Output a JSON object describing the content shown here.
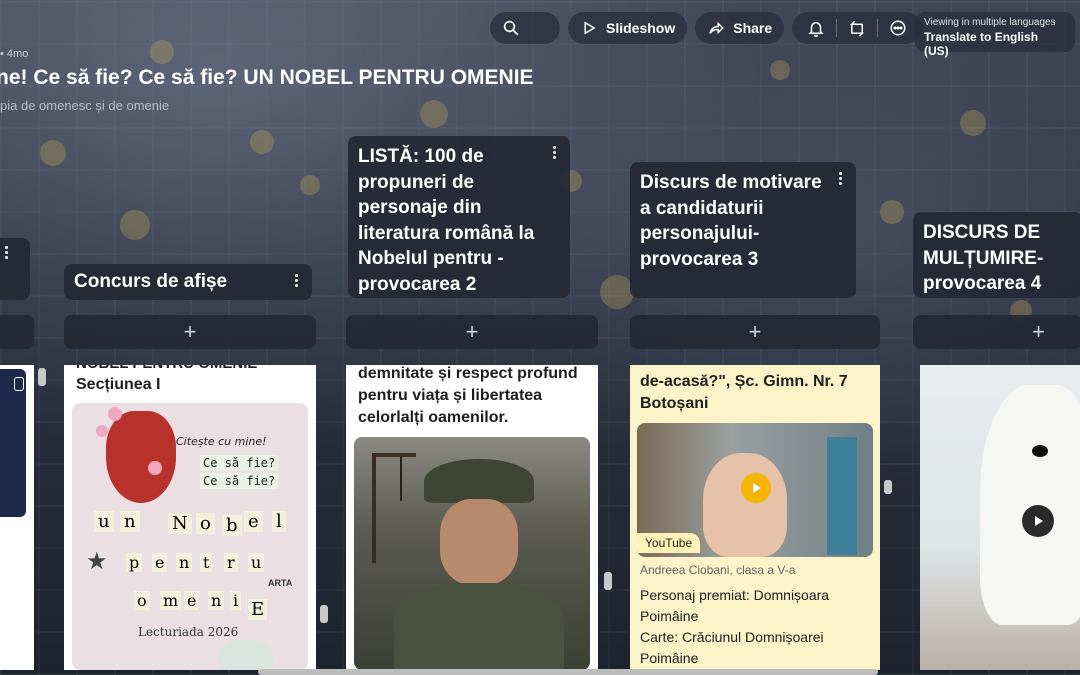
{
  "toolbar": {
    "slideshow_label": "Slideshow",
    "share_label": "Share",
    "icons": [
      "search-icon",
      "play-icon",
      "share-icon",
      "bell-icon",
      "remake-icon",
      "more-icon"
    ]
  },
  "translate": {
    "line1": "Viewing in multiple languages",
    "line2": "Translate to English (US)"
  },
  "board": {
    "meta": "• 4mo",
    "title": "ne! Ce să fie? Ce să fie? UN NOBEL PENTRU OMENIE",
    "subtitle": "pia de omenesc și de omenie"
  },
  "columns": [
    {
      "title": "Concurs de afișe"
    },
    {
      "title": "LISTĂ: 100 de propuneri de personaje din literatura română la Nobelul pentru -provocarea 2"
    },
    {
      "title": "Discurs de motivare a candidaturii personajului-provocarea 3"
    },
    {
      "title": "DISCURS DE MULȚUMIRE-provocarea 4"
    }
  ],
  "add_symbol": "+",
  "cards": {
    "afise": {
      "top_cut": "NOBEL PENTRU OMENIE",
      "section": "Secțiunea I",
      "poster": {
        "heading1": "Citește cu mine!",
        "q1": "Ce să fie?",
        "q2": "Ce să fie?",
        "letters": [
          "u",
          "n",
          "N",
          "o",
          "b",
          "e",
          "l",
          "p",
          "e",
          "n",
          "t",
          "r",
          "u",
          "o",
          "m",
          "e",
          "n",
          "i",
          "E"
        ],
        "arta": "ARTA",
        "footer": "Lecturiada 2026"
      }
    },
    "lista": {
      "text": "demnitate și respect profund pentru viața și libertatea celorlalți oamenilor."
    },
    "discurs": {
      "top_cut": "de-acasă?\", Șc. Gimn. Nr. 7 Botoșani",
      "video_badge": "YouTube",
      "caption": "Andreea Ciobani, clasa a V-a",
      "line1": "Personaj premiat: Domnișoara Poimâine",
      "line2": "Carte: Crăciunul Domnișoarei Poimâine"
    }
  },
  "colors": {
    "column_header_bg": "#242834",
    "card_yellow": "#fdf3c9",
    "youtube_badge": "#fff3b8",
    "play_button": "#f4b400"
  }
}
